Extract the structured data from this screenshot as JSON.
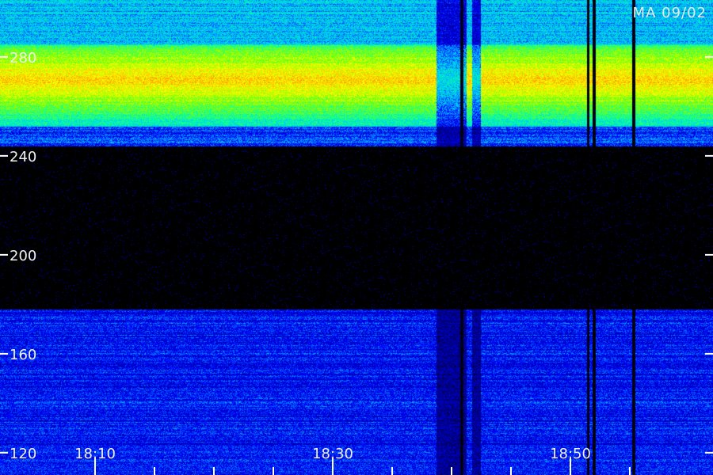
{
  "header": {
    "station_label": "MA 09/02"
  },
  "chart_data": {
    "type": "heatmap",
    "title": "",
    "xlabel": "",
    "ylabel": "",
    "x_range": [
      "18:02",
      "19:02"
    ],
    "ylim": [
      111,
      303
    ],
    "grid": false,
    "x_ticks": [
      {
        "t": "18:10",
        "label": "18:10",
        "major": true
      },
      {
        "t": "18:15",
        "label": "",
        "major": false
      },
      {
        "t": "18:20",
        "label": "",
        "major": false
      },
      {
        "t": "18:25",
        "label": "",
        "major": false
      },
      {
        "t": "18:30",
        "label": "18:30",
        "major": true
      },
      {
        "t": "18:35",
        "label": "",
        "major": false
      },
      {
        "t": "18:40",
        "label": "",
        "major": false
      },
      {
        "t": "18:45",
        "label": "",
        "major": false
      },
      {
        "t": "18:50",
        "label": "18:50",
        "major": true
      },
      {
        "t": "18:55",
        "label": "",
        "major": false
      }
    ],
    "y_ticks": [
      {
        "v": 280,
        "label": "280"
      },
      {
        "v": 240,
        "label": "240"
      },
      {
        "v": 200,
        "label": "200"
      },
      {
        "v": 160,
        "label": "160"
      },
      {
        "v": 120,
        "label": "120"
      }
    ],
    "colormap": [
      "#000000",
      "#00008b",
      "#0000ff",
      "#00bfff",
      "#00ffaa",
      "#7fff00",
      "#ffff00",
      "#ff8c00",
      "#ff0000"
    ],
    "bands": [
      {
        "y_from": 244,
        "y_to": 303,
        "peak": 271,
        "level": "high"
      },
      {
        "y_from": 111,
        "y_to": 178,
        "level": "low"
      }
    ],
    "gaps": [
      {
        "from": "18:38.8",
        "to": "18:41.2",
        "level": "reduced"
      },
      {
        "from": "18:40.8",
        "to": "18:41.0",
        "level": "dropout"
      },
      {
        "from": "18:41.8",
        "to": "18:42.4",
        "level": "reduced"
      },
      {
        "from": "18:51.4",
        "to": "18:51.6",
        "level": "dropout"
      },
      {
        "from": "18:51.9",
        "to": "18:52.1",
        "level": "dropout"
      },
      {
        "from": "18:55.2",
        "to": "18:55.4",
        "level": "dropout"
      }
    ]
  }
}
